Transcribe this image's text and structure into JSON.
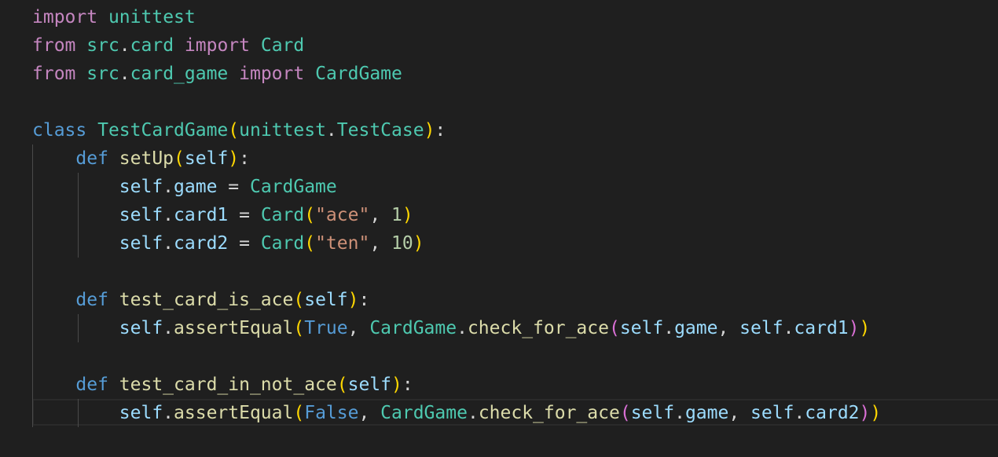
{
  "colors": {
    "background": "#1f1f1f",
    "keyword_import": "#c586c0",
    "keyword": "#569cd6",
    "class_name": "#4ec9b0",
    "function": "#dcdcaa",
    "variable": "#9cdcfe",
    "string": "#ce9178",
    "number": "#b5cea8",
    "plain": "#d4d4d4"
  },
  "editor": {
    "language": "python",
    "lines": [
      [
        {
          "t": "import",
          "k": "kw-imp"
        },
        {
          "t": " "
        },
        {
          "t": "unittest",
          "k": "mod"
        }
      ],
      [
        {
          "t": "from",
          "k": "kw-imp"
        },
        {
          "t": " "
        },
        {
          "t": "src",
          "k": "mod"
        },
        {
          "t": "."
        },
        {
          "t": "card",
          "k": "mod"
        },
        {
          "t": " "
        },
        {
          "t": "import",
          "k": "kw-imp"
        },
        {
          "t": " "
        },
        {
          "t": "Card",
          "k": "cls"
        }
      ],
      [
        {
          "t": "from",
          "k": "kw-imp"
        },
        {
          "t": " "
        },
        {
          "t": "src",
          "k": "mod"
        },
        {
          "t": "."
        },
        {
          "t": "card_game",
          "k": "mod"
        },
        {
          "t": " "
        },
        {
          "t": "import",
          "k": "kw-imp"
        },
        {
          "t": " "
        },
        {
          "t": "CardGame",
          "k": "cls"
        }
      ],
      [],
      [
        {
          "t": "class",
          "k": "kw"
        },
        {
          "t": " "
        },
        {
          "t": "TestCardGame",
          "k": "cls"
        },
        {
          "t": "(",
          "k": "brk1"
        },
        {
          "t": "unittest",
          "k": "mod"
        },
        {
          "t": "."
        },
        {
          "t": "TestCase",
          "k": "cls"
        },
        {
          "t": ")",
          "k": "brk1"
        },
        {
          "t": ":"
        }
      ],
      [
        {
          "t": "    "
        },
        {
          "t": "def",
          "k": "kw"
        },
        {
          "t": " "
        },
        {
          "t": "setUp",
          "k": "fn"
        },
        {
          "t": "(",
          "k": "brk1"
        },
        {
          "t": "self",
          "k": "var"
        },
        {
          "t": ")",
          "k": "brk1"
        },
        {
          "t": ":"
        }
      ],
      [
        {
          "t": "        "
        },
        {
          "t": "self",
          "k": "var"
        },
        {
          "t": "."
        },
        {
          "t": "game",
          "k": "var"
        },
        {
          "t": " = "
        },
        {
          "t": "CardGame",
          "k": "cls"
        }
      ],
      [
        {
          "t": "        "
        },
        {
          "t": "self",
          "k": "var"
        },
        {
          "t": "."
        },
        {
          "t": "card1",
          "k": "var"
        },
        {
          "t": " = "
        },
        {
          "t": "Card",
          "k": "cls"
        },
        {
          "t": "(",
          "k": "brk1"
        },
        {
          "t": "\"ace\"",
          "k": "str"
        },
        {
          "t": ", "
        },
        {
          "t": "1",
          "k": "num"
        },
        {
          "t": ")",
          "k": "brk1"
        }
      ],
      [
        {
          "t": "        "
        },
        {
          "t": "self",
          "k": "var"
        },
        {
          "t": "."
        },
        {
          "t": "card2",
          "k": "var"
        },
        {
          "t": " = "
        },
        {
          "t": "Card",
          "k": "cls"
        },
        {
          "t": "(",
          "k": "brk1"
        },
        {
          "t": "\"ten\"",
          "k": "str"
        },
        {
          "t": ", "
        },
        {
          "t": "10",
          "k": "num"
        },
        {
          "t": ")",
          "k": "brk1"
        }
      ],
      [],
      [
        {
          "t": "    "
        },
        {
          "t": "def",
          "k": "kw"
        },
        {
          "t": " "
        },
        {
          "t": "test_card_is_ace",
          "k": "fn"
        },
        {
          "t": "(",
          "k": "brk1"
        },
        {
          "t": "self",
          "k": "var"
        },
        {
          "t": ")",
          "k": "brk1"
        },
        {
          "t": ":"
        }
      ],
      [
        {
          "t": "        "
        },
        {
          "t": "self",
          "k": "var"
        },
        {
          "t": "."
        },
        {
          "t": "assertEqual",
          "k": "fn"
        },
        {
          "t": "(",
          "k": "brk1"
        },
        {
          "t": "True",
          "k": "bool"
        },
        {
          "t": ", "
        },
        {
          "t": "CardGame",
          "k": "cls"
        },
        {
          "t": "."
        },
        {
          "t": "check_for_ace",
          "k": "fn"
        },
        {
          "t": "(",
          "k": "brk2"
        },
        {
          "t": "self",
          "k": "var"
        },
        {
          "t": "."
        },
        {
          "t": "game",
          "k": "var"
        },
        {
          "t": ", "
        },
        {
          "t": "self",
          "k": "var"
        },
        {
          "t": "."
        },
        {
          "t": "card1",
          "k": "var"
        },
        {
          "t": ")",
          "k": "brk2"
        },
        {
          "t": ")",
          "k": "brk1"
        }
      ],
      [],
      [
        {
          "t": "    "
        },
        {
          "t": "def",
          "k": "kw"
        },
        {
          "t": " "
        },
        {
          "t": "test_card_in_not_ace",
          "k": "fn"
        },
        {
          "t": "(",
          "k": "brk1"
        },
        {
          "t": "self",
          "k": "var"
        },
        {
          "t": ")",
          "k": "brk1"
        },
        {
          "t": ":"
        }
      ],
      [
        {
          "t": "        "
        },
        {
          "t": "self",
          "k": "var"
        },
        {
          "t": "."
        },
        {
          "t": "assertEqual",
          "k": "fn"
        },
        {
          "t": "(",
          "k": "brk1"
        },
        {
          "t": "False",
          "k": "bool"
        },
        {
          "t": ", "
        },
        {
          "t": "CardGame",
          "k": "cls"
        },
        {
          "t": "."
        },
        {
          "t": "check_for_ace",
          "k": "fn"
        },
        {
          "t": "(",
          "k": "brk2"
        },
        {
          "t": "self",
          "k": "var"
        },
        {
          "t": "."
        },
        {
          "t": "game",
          "k": "var"
        },
        {
          "t": ", "
        },
        {
          "t": "self",
          "k": "var"
        },
        {
          "t": "."
        },
        {
          "t": "card2",
          "k": "var"
        },
        {
          "t": ")",
          "k": "brk2"
        },
        {
          "t": ")",
          "k": "brk1"
        }
      ]
    ]
  }
}
